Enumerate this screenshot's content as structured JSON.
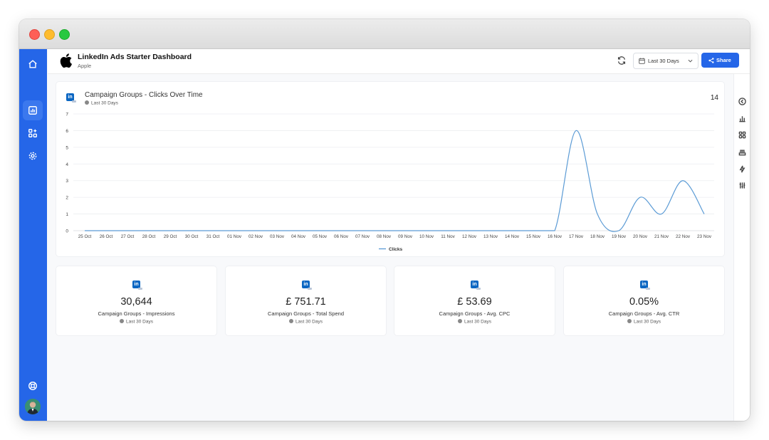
{
  "app": {
    "dashboard_title": "LinkedIn Ads Starter Dashboard",
    "account_name": "Apple"
  },
  "topbar": {
    "date_range": "Last 30 Days",
    "share_label": "Share"
  },
  "sidebar": {
    "items": [
      "home-icon",
      "reports-icon",
      "widgets-icon",
      "settings-icon"
    ],
    "bottom": [
      "help-icon",
      "avatar"
    ]
  },
  "rightbar": {
    "icons": [
      "back-icon",
      "chart-icon",
      "grid-icon",
      "stack-icon",
      "sparkle-icon",
      "sliders-icon"
    ]
  },
  "chart_card": {
    "title": "Campaign Groups - Clicks Over Time",
    "period": "Last 30 Days",
    "total": "14"
  },
  "chart_data": {
    "type": "line",
    "title": "Campaign Groups - Clicks Over Time",
    "x": [
      "25 Oct",
      "26 Oct",
      "27 Oct",
      "28 Oct",
      "29 Oct",
      "30 Oct",
      "31 Oct",
      "01 Nov",
      "02 Nov",
      "03 Nov",
      "04 Nov",
      "05 Nov",
      "06 Nov",
      "07 Nov",
      "08 Nov",
      "09 Nov",
      "10 Nov",
      "11 Nov",
      "12 Nov",
      "13 Nov",
      "14 Nov",
      "15 Nov",
      "16 Nov",
      "17 Nov",
      "18 Nov",
      "19 Nov",
      "20 Nov",
      "21 Nov",
      "22 Nov",
      "23 Nov"
    ],
    "series": [
      {
        "name": "Clicks",
        "values": [
          0,
          0,
          0,
          0,
          0,
          0,
          0,
          0,
          0,
          0,
          0,
          0,
          0,
          0,
          0,
          0,
          0,
          0,
          0,
          0,
          0,
          0,
          0,
          6,
          1,
          0,
          2,
          1,
          3,
          1
        ]
      }
    ],
    "yticks": [
      0,
      1,
      2,
      3,
      4,
      5,
      6,
      7
    ],
    "ylim": [
      0,
      7
    ],
    "grid": true,
    "legend": "bottom",
    "color": "#5b9bd5"
  },
  "kpis": [
    {
      "value": "30,644",
      "label": "Campaign Groups - Impressions",
      "period": "Last 30 Days"
    },
    {
      "value": "£ 751.71",
      "label": "Campaign Groups - Total Spend",
      "period": "Last 30 Days"
    },
    {
      "value": "£ 53.69",
      "label": "Campaign Groups - Avg. CPC",
      "period": "Last 30 Days"
    },
    {
      "value": "0.05%",
      "label": "Campaign Groups - Avg. CTR",
      "period": "Last 30 Days"
    }
  ],
  "colors": {
    "sidebar": "#2566e8",
    "primary": "#2566e8",
    "linkedin": "#0a66c2"
  }
}
